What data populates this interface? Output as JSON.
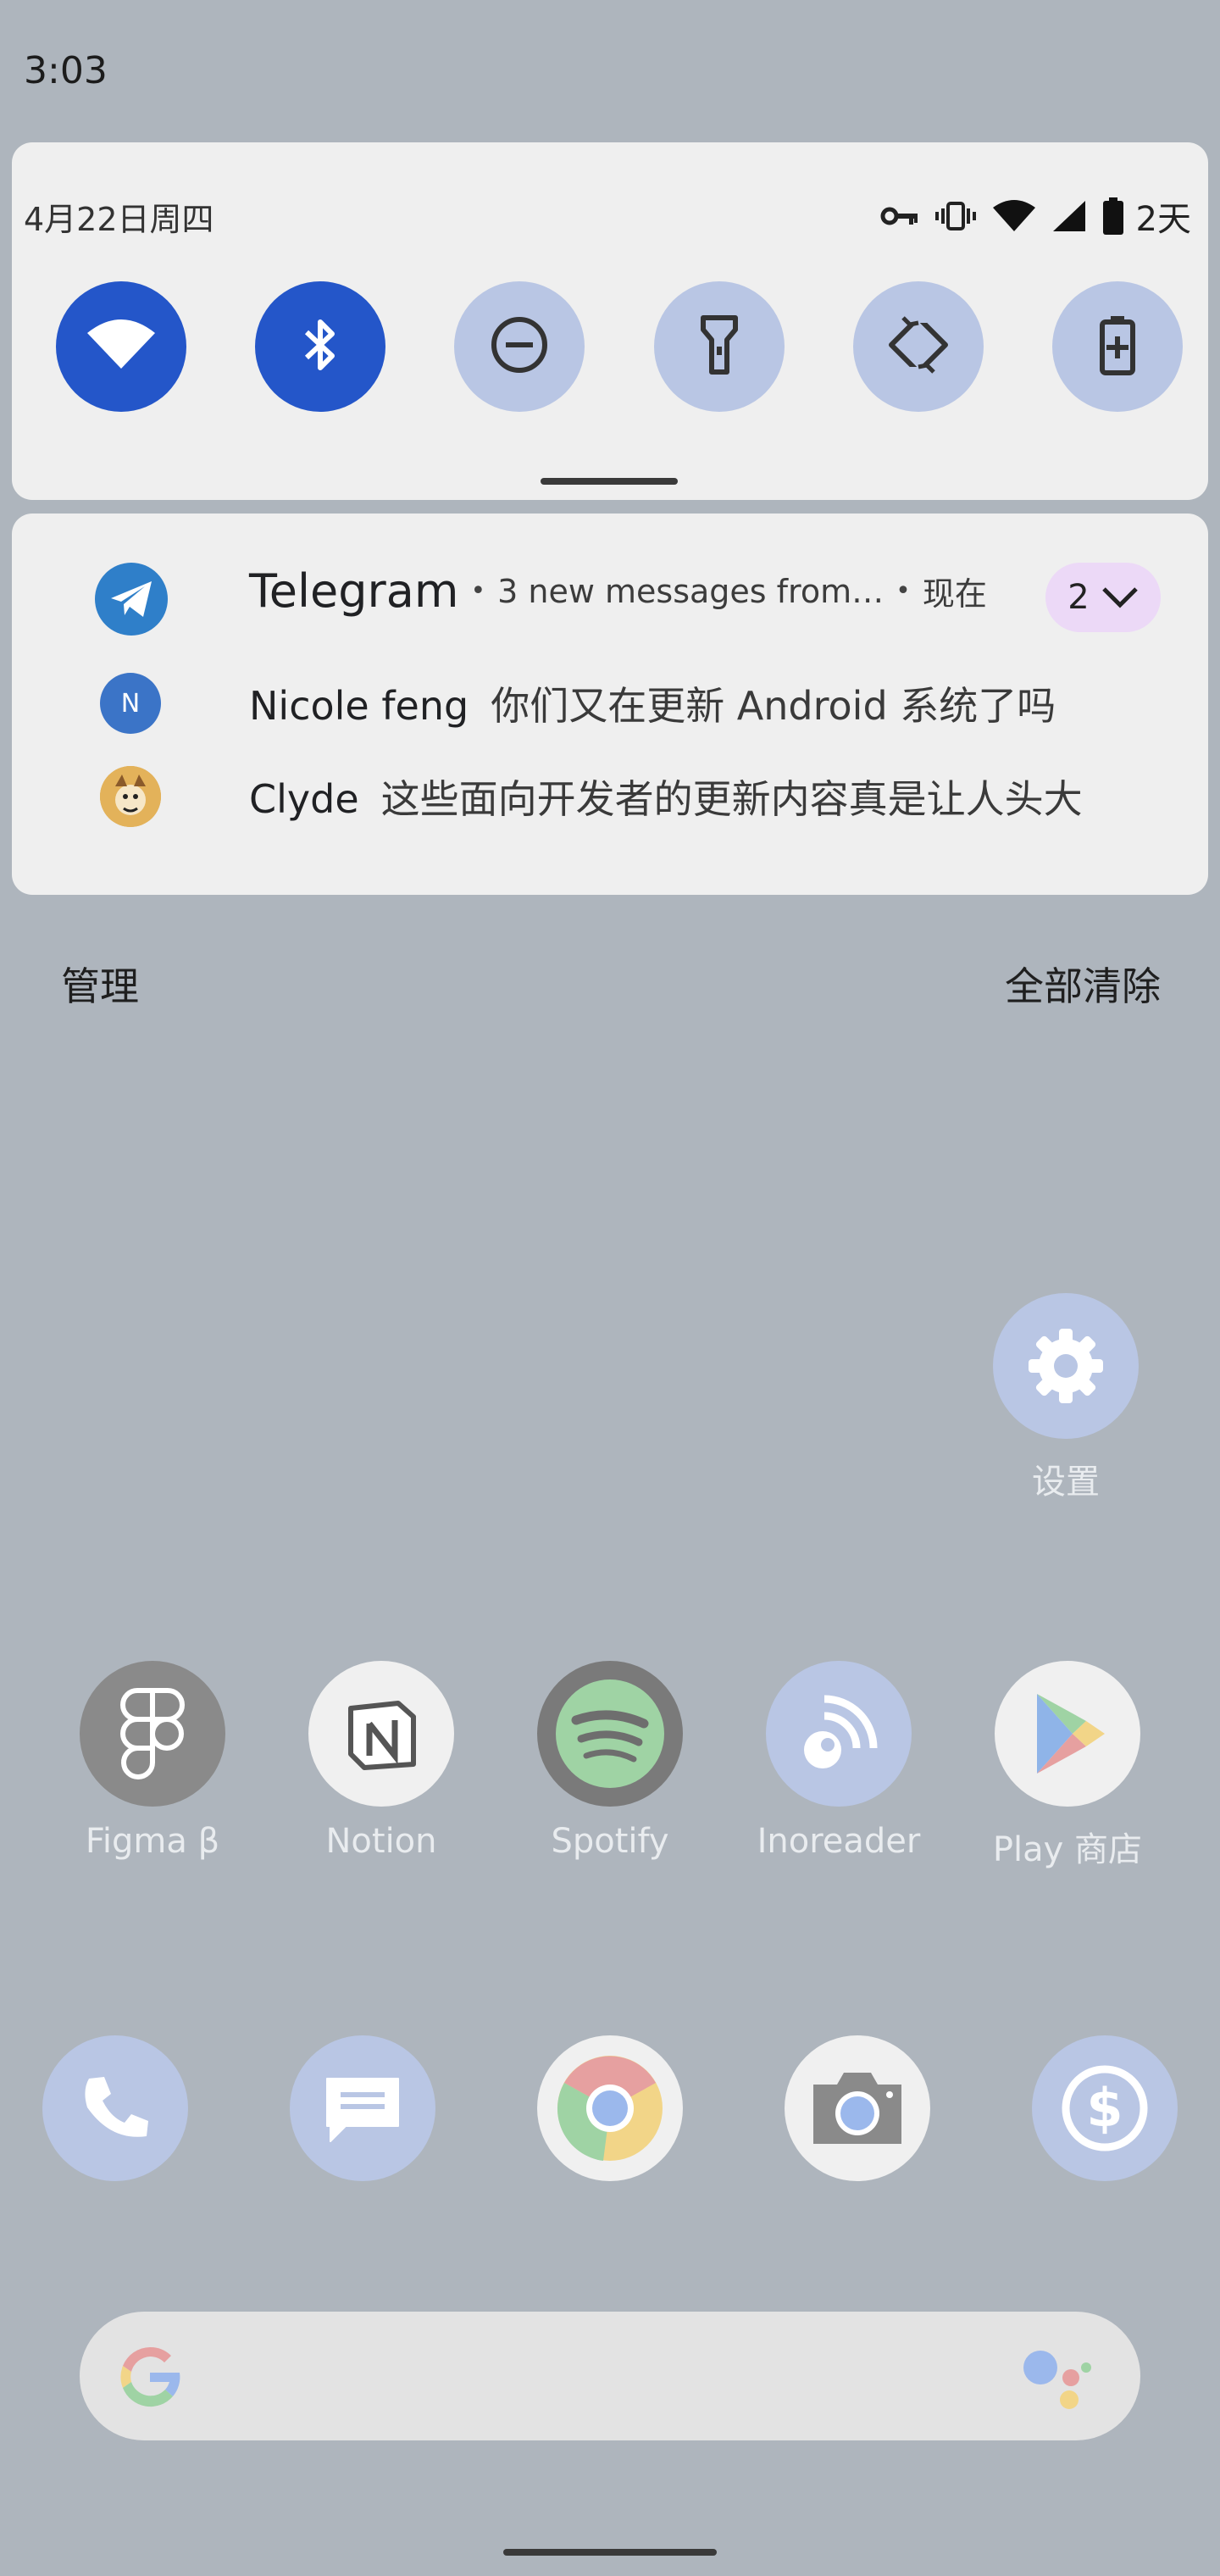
{
  "status_bar": {
    "time": "3:03"
  },
  "quick_settings": {
    "date": "4月22日周四",
    "battery_label": "2天",
    "status_icons": [
      "vpn-key-icon",
      "vibrate-icon",
      "wifi-signal-icon",
      "cell-signal-icon",
      "battery-icon"
    ],
    "tiles": [
      {
        "name": "wifi",
        "icon": "wifi-icon",
        "state": "on"
      },
      {
        "name": "bluetooth",
        "icon": "bluetooth-icon",
        "state": "on"
      },
      {
        "name": "do-not-disturb",
        "icon": "do-not-disturb-icon",
        "state": "off"
      },
      {
        "name": "flashlight",
        "icon": "flashlight-icon",
        "state": "off"
      },
      {
        "name": "auto-rotate",
        "icon": "auto-rotate-icon",
        "state": "off"
      },
      {
        "name": "battery-saver",
        "icon": "battery-saver-icon",
        "state": "off"
      }
    ]
  },
  "notification": {
    "app": "Telegram",
    "title": "3 new messages from…",
    "when": "现在",
    "count": "2",
    "messages": [
      {
        "avatar": "N",
        "name": "Nicole feng",
        "text": "你们又在更新 Android 系统了吗"
      },
      {
        "avatar": "",
        "name": "Clyde",
        "text": "这些面向开发者的更新内容真是让人头大"
      }
    ]
  },
  "actions": {
    "manage": "管理",
    "clear_all": "全部清除"
  },
  "home": {
    "settings": {
      "label": "设置",
      "icon": "gear-icon"
    },
    "apps": [
      {
        "label": "Figma β",
        "icon": "figma-icon"
      },
      {
        "label": "Notion",
        "icon": "notion-icon"
      },
      {
        "label": "Spotify",
        "icon": "spotify-icon"
      },
      {
        "label": "Inoreader",
        "icon": "inoreader-icon"
      },
      {
        "label": "Play 商店",
        "icon": "play-store-icon"
      }
    ],
    "dock": [
      {
        "icon": "phone-icon"
      },
      {
        "icon": "messages-icon"
      },
      {
        "icon": "chrome-icon"
      },
      {
        "icon": "camera-icon"
      },
      {
        "icon": "pay-icon"
      }
    ]
  },
  "colors": {
    "accent_on": "#2456c9",
    "tile_off": "#b9c6e4",
    "background": "#aeb5bd"
  }
}
